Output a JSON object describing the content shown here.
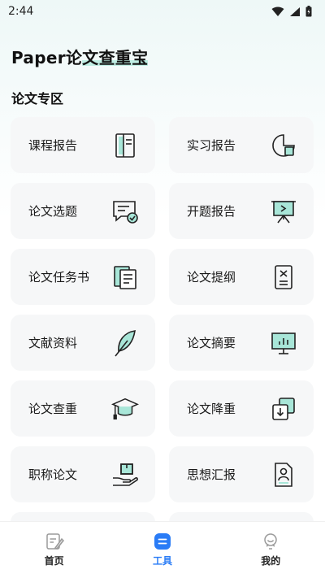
{
  "status_bar": {
    "time": "2:44"
  },
  "header": {
    "title_prefix": "Paper论",
    "title_highlight": "文查重宝"
  },
  "section": {
    "title": "论文专区"
  },
  "cards": [
    {
      "label": "课程报告",
      "icon": "notebook-icon"
    },
    {
      "label": "实习报告",
      "icon": "chart-frame-icon"
    },
    {
      "label": "论文选题",
      "icon": "message-check-icon"
    },
    {
      "label": "开题报告",
      "icon": "presentation-board-icon"
    },
    {
      "label": "论文任务书",
      "icon": "documents-icon"
    },
    {
      "label": "论文提纲",
      "icon": "document-outline-icon"
    },
    {
      "label": "文献资料",
      "icon": "feather-icon"
    },
    {
      "label": "论文摘要",
      "icon": "bar-chart-icon"
    },
    {
      "label": "论文查重",
      "icon": "graduation-cap-icon"
    },
    {
      "label": "论文降重",
      "icon": "layers-download-icon"
    },
    {
      "label": "职称论文",
      "icon": "hand-box-icon"
    },
    {
      "label": "思想汇报",
      "icon": "profile-document-icon"
    }
  ],
  "tab_bar": {
    "tabs": [
      {
        "label": "首页",
        "icon": "home-doc-icon"
      },
      {
        "label": "工具",
        "icon": "tools-icon"
      },
      {
        "label": "我的",
        "icon": "profile-icon"
      }
    ],
    "active_index": 1
  },
  "colors": {
    "accent": "#2a7cf6",
    "highlight": "#bfeee4",
    "icon_teal": "#a8e6d8"
  }
}
